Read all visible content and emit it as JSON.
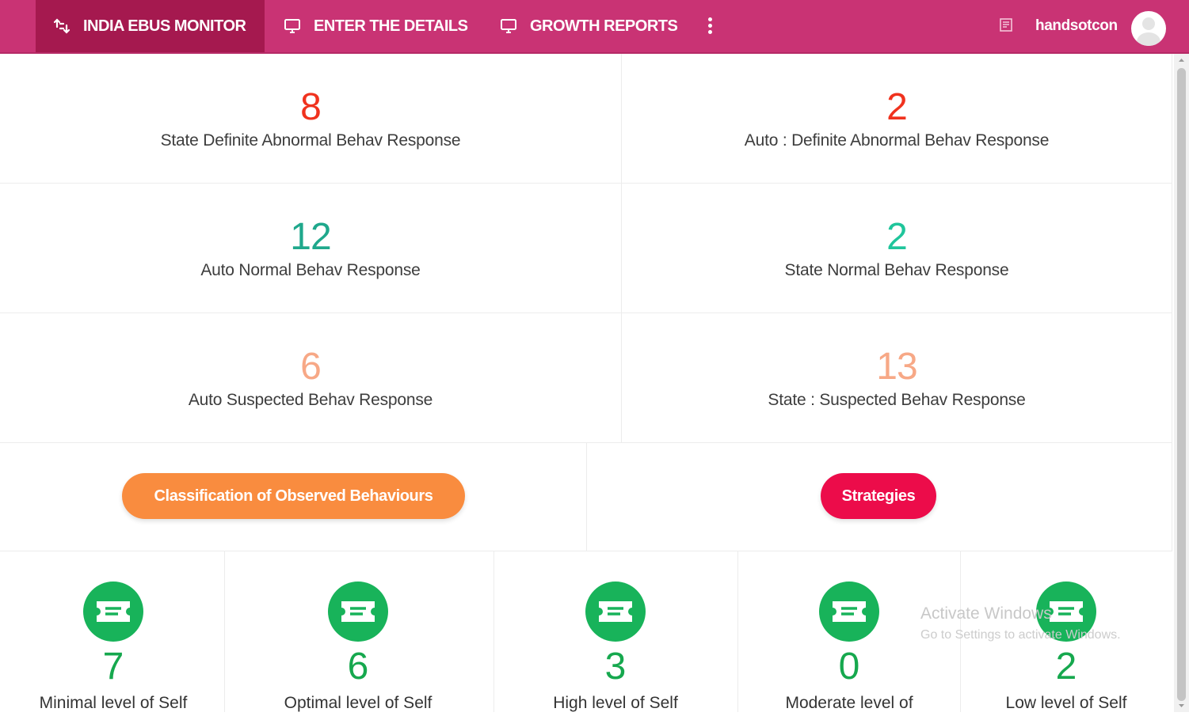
{
  "navbar": {
    "brand": "INDIA EBUS MONITOR",
    "items": [
      {
        "label": "ENTER THE DETAILS",
        "icon": "monitor-icon"
      },
      {
        "label": "GROWTH REPORTS",
        "icon": "monitor-icon"
      }
    ],
    "username": "handsotcon"
  },
  "stats": [
    {
      "value": "8",
      "label": "State Definite Abnormal Behav Response",
      "color": "#f0321e"
    },
    {
      "value": "2",
      "label": "Auto : Definite Abnormal Behav Response",
      "color": "#f0321e"
    },
    {
      "value": "12",
      "label": "Auto Normal Behav Response",
      "color": "#1fa88c"
    },
    {
      "value": "2",
      "label": "State Normal Behav Response",
      "color": "#1fc59b"
    },
    {
      "value": "6",
      "label": "Auto Suspected Behav Response",
      "color": "#f7a886"
    },
    {
      "value": "13",
      "label": "State : Suspected Behav Response",
      "color": "#f7a886"
    }
  ],
  "buttons": {
    "classification": {
      "label": "Classification of Observed Behaviours",
      "color": "#f98c3f"
    },
    "strategies": {
      "label": "Strategies",
      "color": "#ec0c4a"
    }
  },
  "levels": [
    {
      "value": "7",
      "label": "Minimal level of Self"
    },
    {
      "value": "6",
      "label": "Optimal level of Self"
    },
    {
      "value": "3",
      "label": "High level of Self"
    },
    {
      "value": "0",
      "label": "Moderate level of"
    },
    {
      "value": "2",
      "label": "Low level of Self"
    }
  ],
  "watermark": {
    "title": "Activate Windows",
    "subtitle": "Go to Settings to activate Windows."
  }
}
